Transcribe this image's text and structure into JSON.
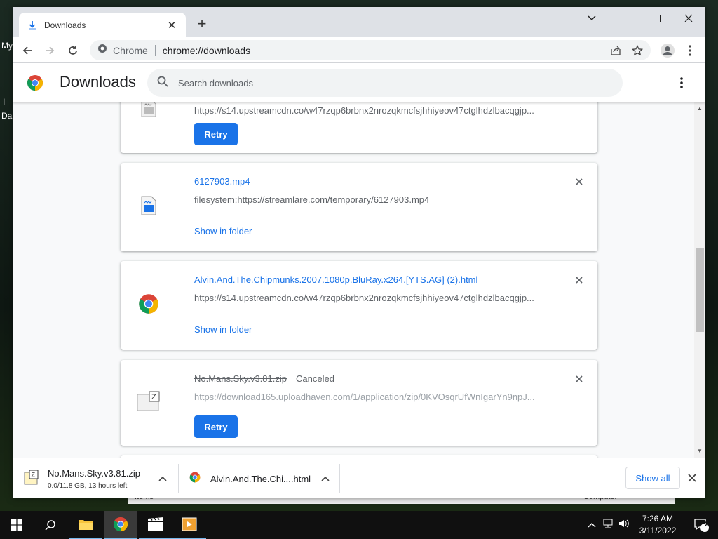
{
  "desktop": {
    "left_labels": [
      "My",
      "I",
      "Da"
    ],
    "background_window_left": "Items",
    "background_window_right": "Computer"
  },
  "browser": {
    "tab_title": "Downloads",
    "omnibox_site": "Chrome",
    "omnibox_url": "chrome://downloads"
  },
  "page": {
    "title": "Downloads",
    "search_placeholder": "Search downloads",
    "items": [
      {
        "url": "https://s14.upstreamcdn.co/w47rzqp6brbnx2nrozqkmcfsjhhiyeov47ctglhdzlbacqgjp...",
        "action": "Retry"
      },
      {
        "filename": "6127903.mp4",
        "url": "filesystem:https://streamlare.com/temporary/6127903.mp4",
        "action": "Show in folder"
      },
      {
        "filename": "Alvin.And.The.Chipmunks.2007.1080p.BluRay.x264.[YTS.AG] (2).html",
        "url": "https://s14.upstreamcdn.co/w47rzqp6brbnx2nrozqkmcfsjhhiyeov47ctglhdzlbacqgjp...",
        "action": "Show in folder"
      },
      {
        "filename": "No.Mans.Sky.v3.81.zip",
        "status": "Canceled",
        "url": "https://download165.uploadhaven.com/1/application/zip/0KVOsqrUfWnIgarYn9npJ...",
        "action": "Retry"
      }
    ]
  },
  "shelf": {
    "item1_name": "No.Mans.Sky.v3.81.zip",
    "item1_status": "0.0/11.8 GB, 13 hours left",
    "item2_name": "Alvin.And.The.Chi....html",
    "show_all": "Show all"
  },
  "taskbar": {
    "time": "7:26 AM",
    "date": "3/11/2022",
    "notification_count": "2"
  },
  "colors": {
    "accent": "#1a73e8",
    "tabstrip": "#dee1e6",
    "content_bg": "#f8f9fa"
  }
}
